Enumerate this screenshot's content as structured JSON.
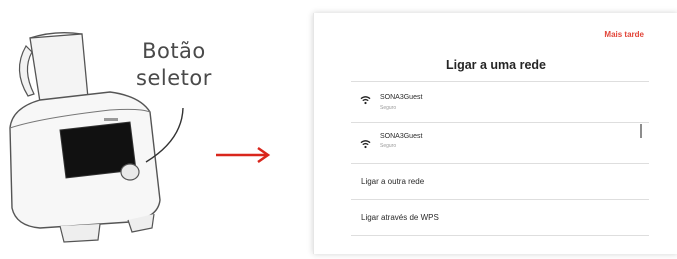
{
  "callout": {
    "line1": "Botão",
    "line2": "seletor"
  },
  "screen": {
    "later_label": "Mais tarde",
    "title": "Ligar a uma rede",
    "networks": [
      {
        "name": "SONA3Guest",
        "security": "Seguro"
      },
      {
        "name": "SONA3Guest",
        "security": "Seguro"
      }
    ],
    "actions": [
      {
        "label": "Ligar a outra rede"
      },
      {
        "label": "Ligar através de WPS"
      }
    ]
  },
  "colors": {
    "accent": "#e2463a",
    "arrow": "#d9261c"
  },
  "icons": {
    "network": "wifi-icon",
    "flow": "arrow-right-icon"
  }
}
